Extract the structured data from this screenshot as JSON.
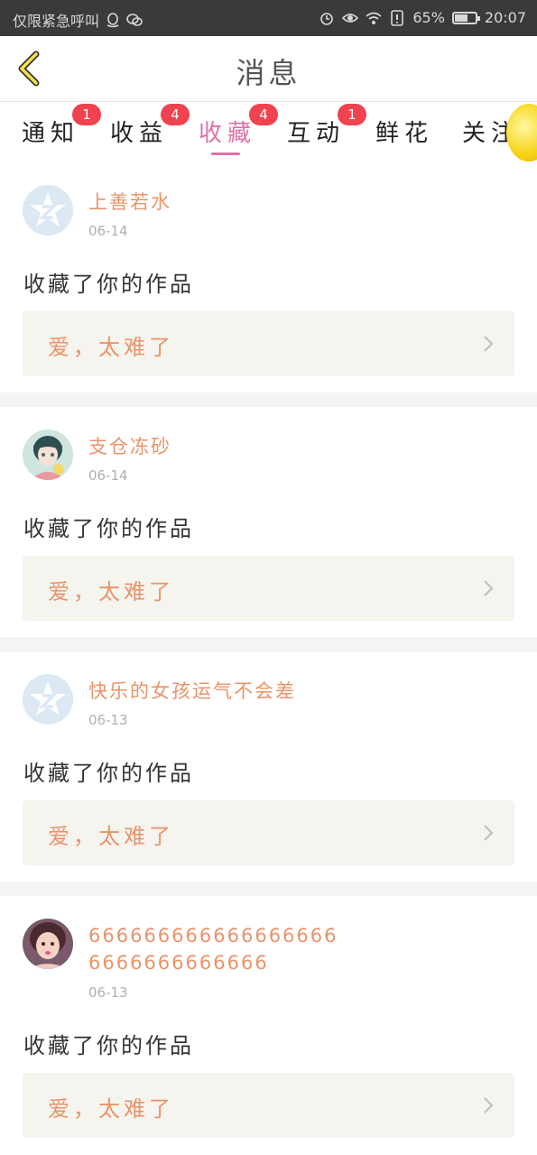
{
  "status_bar": {
    "left_text": "仅限紧急呼叫",
    "battery_percent": "65%",
    "battery_level": 0.65,
    "time": "20:07"
  },
  "header": {
    "title": "消息"
  },
  "tabs": [
    {
      "label": "通知",
      "badge": "1"
    },
    {
      "label": "收益",
      "badge": "4"
    },
    {
      "label": "收藏",
      "badge": "4",
      "active": true
    },
    {
      "label": "互动",
      "badge": "1"
    },
    {
      "label": "鲜花",
      "badge": ""
    },
    {
      "label": "关注",
      "badge": ""
    }
  ],
  "items": [
    {
      "user": "上善若水",
      "date": "06-14",
      "action": "收藏了你的作品",
      "work": "爱，太难了",
      "avatar": "default"
    },
    {
      "user": "支仓冻砂",
      "date": "06-14",
      "action": "收藏了你的作品",
      "work": "爱，太难了",
      "avatar": "anime"
    },
    {
      "user": "快乐的女孩运气不会差",
      "date": "06-13",
      "action": "收藏了你的作品",
      "work": "爱，太难了",
      "avatar": "default"
    },
    {
      "user": "6666666666666666666666666666666",
      "date": "06-13",
      "action": "收藏了你的作品",
      "work": "爱，太难了",
      "avatar": "photo"
    }
  ],
  "colors": {
    "accent": "#e070a8",
    "username": "#e8946a",
    "badge": "#f0424f"
  }
}
